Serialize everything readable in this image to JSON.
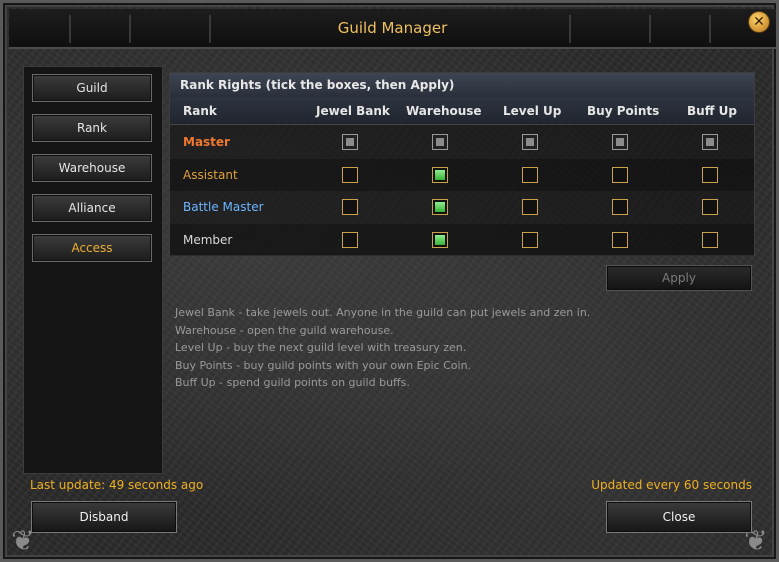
{
  "window": {
    "title": "Guild Manager",
    "close_glyph": "✕"
  },
  "sidebar": {
    "items": [
      {
        "label": "Guild",
        "active": false
      },
      {
        "label": "Rank",
        "active": false
      },
      {
        "label": "Warehouse",
        "active": false
      },
      {
        "label": "Alliance",
        "active": false
      },
      {
        "label": "Access",
        "active": true
      }
    ]
  },
  "rights": {
    "header": "Rank Rights  (tick the boxes, then Apply)",
    "columns": [
      "Rank",
      "Jewel Bank",
      "Warehouse",
      "Level Up",
      "Buy Points",
      "Buff Up"
    ],
    "rows": [
      {
        "name": "Master",
        "color": "#f07830",
        "bold": true,
        "perms": [
          "locked",
          "locked",
          "locked",
          "locked",
          "locked"
        ]
      },
      {
        "name": "Assistant",
        "color": "#e0a040",
        "bold": false,
        "perms": [
          "unchecked",
          "checked",
          "unchecked",
          "unchecked",
          "unchecked"
        ]
      },
      {
        "name": "Battle Master",
        "color": "#6cb4ff",
        "bold": false,
        "perms": [
          "unchecked",
          "checked",
          "unchecked",
          "unchecked",
          "unchecked"
        ]
      },
      {
        "name": "Member",
        "color": "#d8d8d8",
        "bold": false,
        "perms": [
          "unchecked",
          "checked",
          "unchecked",
          "unchecked",
          "unchecked"
        ]
      }
    ],
    "apply_label": "Apply"
  },
  "notes": [
    "Jewel Bank - take jewels out. Anyone in the guild can put jewels and zen in.",
    "Warehouse - open the guild warehouse.",
    "Level Up - buy the next guild level with treasury zen.",
    "Buy Points - buy guild points with your own Epic Coin.",
    "Buff Up - spend guild points on guild buffs."
  ],
  "status": {
    "last_update": "Last update: 49 seconds ago",
    "refresh_info": "Updated every 60 seconds"
  },
  "footer": {
    "disband_label": "Disband",
    "close_label": "Close"
  },
  "colors": {
    "accent": "#f0b020",
    "title": "#f0c060",
    "checked": "#4cc04c",
    "box_border": "#c9a24a"
  }
}
